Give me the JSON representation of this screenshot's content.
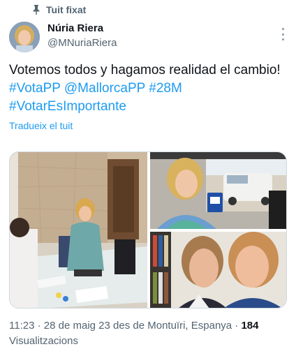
{
  "pinned": {
    "label": "Tuit fixat",
    "icon": "pin-icon"
  },
  "author": {
    "name": "Núria Riera",
    "handle": "@MNuriaRiera",
    "avatar_icon": "avatar"
  },
  "tweet": {
    "text_parts": [
      {
        "text": "Votemos todos y hagamos realidad el cambio! ",
        "link": false
      },
      {
        "text": "#VotaPP",
        "link": true
      },
      {
        "text": " ",
        "link": false
      },
      {
        "text": "@MallorcaPP",
        "link": true
      },
      {
        "text": " ",
        "link": false
      },
      {
        "text": "#28M",
        "link": true
      },
      {
        "text": " ",
        "link": false
      },
      {
        "text": "#VotarEsImportante",
        "link": true
      }
    ],
    "translate_label": "Tradueix el tuit"
  },
  "media": {
    "photos": [
      {
        "name": "photo-polling-station"
      },
      {
        "name": "photo-car-selfie"
      },
      {
        "name": "photo-two-women-selfie"
      }
    ]
  },
  "meta": {
    "time": "11:23",
    "sep1": " · ",
    "date": "28 de maig 23",
    "location": " des de Montuïri, Espanya",
    "sep2": " · ",
    "views_count": "184",
    "views_label": "Visualitzacions"
  },
  "colors": {
    "link": "#1d9bf0",
    "secondary_text": "#536471",
    "primary_text": "#0f1419",
    "border": "#cfd9de"
  }
}
